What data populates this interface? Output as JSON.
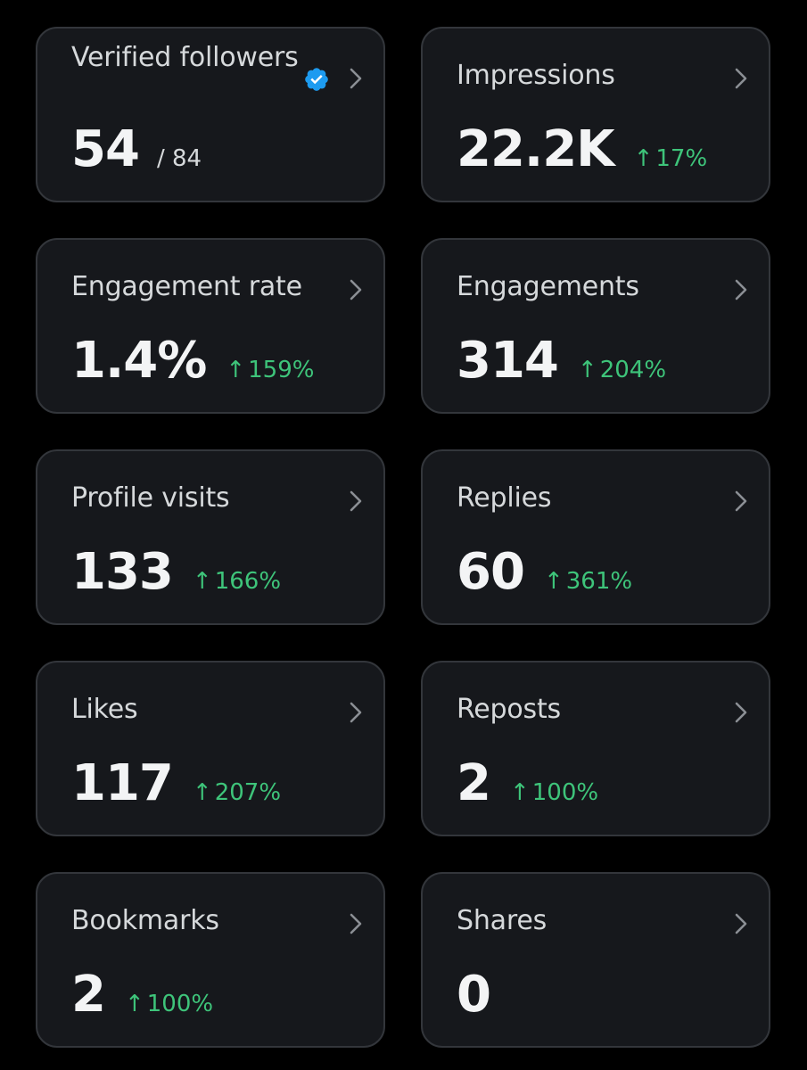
{
  "cards": [
    {
      "title": "Verified followers",
      "value": "54",
      "total": "/ 84",
      "verified_icon": "verified-badge-icon",
      "verified_color": "#1d9bf0"
    },
    {
      "title": "Impressions",
      "value": "22.2K",
      "change": "17%"
    },
    {
      "title": "Engagement rate",
      "value": "1.4%",
      "change": "159%"
    },
    {
      "title": "Engagements",
      "value": "314",
      "change": "204%"
    },
    {
      "title": "Profile visits",
      "value": "133",
      "change": "166%"
    },
    {
      "title": "Replies",
      "value": "60",
      "change": "361%"
    },
    {
      "title": "Likes",
      "value": "117",
      "change": "207%"
    },
    {
      "title": "Reposts",
      "value": "2",
      "change": "100%"
    },
    {
      "title": "Bookmarks",
      "value": "2",
      "change": "100%"
    },
    {
      "title": "Shares",
      "value": "0"
    }
  ],
  "arrow_glyph": "↑",
  "icons": {
    "chevron": "chevron-right-icon",
    "change_arrow": "arrow-up-icon"
  },
  "colors": {
    "background": "#000000",
    "card": "#16181c",
    "card_border": "#33363b",
    "positive": "#3ec47a",
    "verified": "#1d9bf0"
  }
}
